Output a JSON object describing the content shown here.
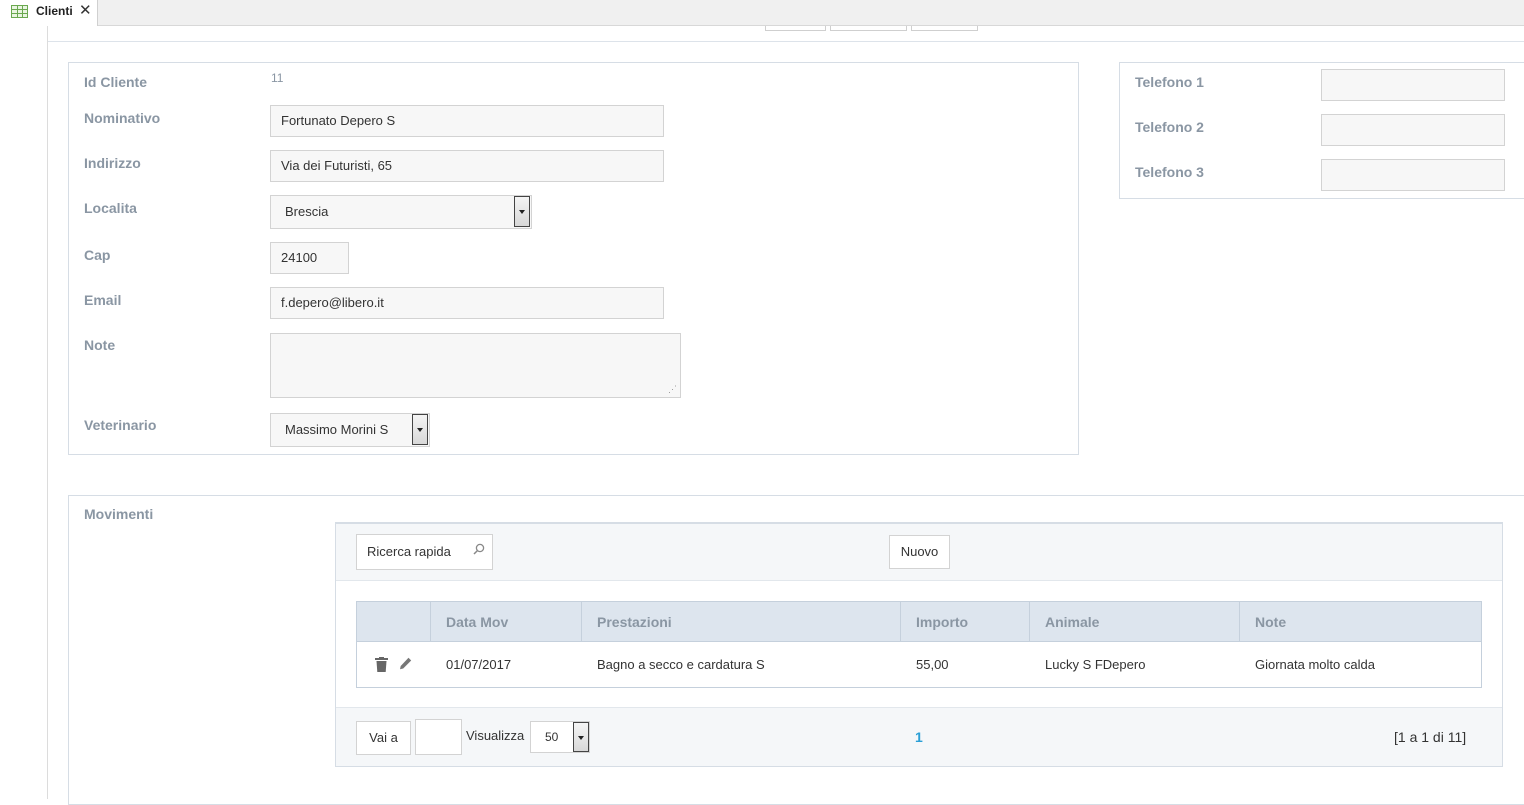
{
  "tab": {
    "label": "Clienti",
    "close": "✕"
  },
  "form": {
    "id_cliente": {
      "label": "Id Cliente",
      "value": "11"
    },
    "nominativo": {
      "label": "Nominativo",
      "value": "Fortunato Depero S"
    },
    "indirizzo": {
      "label": "Indirizzo",
      "value": "Via dei Futuristi, 65"
    },
    "localita": {
      "label": "Localita",
      "value": "Brescia"
    },
    "cap": {
      "label": "Cap",
      "value": "24100"
    },
    "email": {
      "label": "Email",
      "value": "f.depero@libero.it"
    },
    "note": {
      "label": "Note",
      "value": ""
    },
    "veterinario": {
      "label": "Veterinario",
      "value": "Massimo Morini S"
    }
  },
  "phones": {
    "telefono1": {
      "label": "Telefono 1",
      "value": ""
    },
    "telefono2": {
      "label": "Telefono 2",
      "value": ""
    },
    "telefono3": {
      "label": "Telefono 3",
      "value": ""
    }
  },
  "movimenti": {
    "label": "Movimenti",
    "search_placeholder": "Ricerca rapida",
    "new_label": "Nuovo",
    "columns": [
      "Data Mov",
      "Prestazioni",
      "Importo",
      "Animale",
      "Note"
    ],
    "rows": [
      {
        "data_mov": "01/07/2017",
        "prestazioni": "Bagno a secco e cardatura S",
        "importo": "55,00",
        "animale": "Lucky S FDepero",
        "note": "Giornata molto calda"
      }
    ],
    "pager": {
      "goto_label": "Vai a",
      "goto_value": "",
      "show_label": "Visualizza",
      "page_size": "50",
      "current_page": "1",
      "range": "[1 a 1 di 11]"
    }
  },
  "colors": {
    "label": "#8a96a3",
    "border": "#d6dde5",
    "header_bg": "#dde5ee",
    "link": "#2a9fd6"
  }
}
